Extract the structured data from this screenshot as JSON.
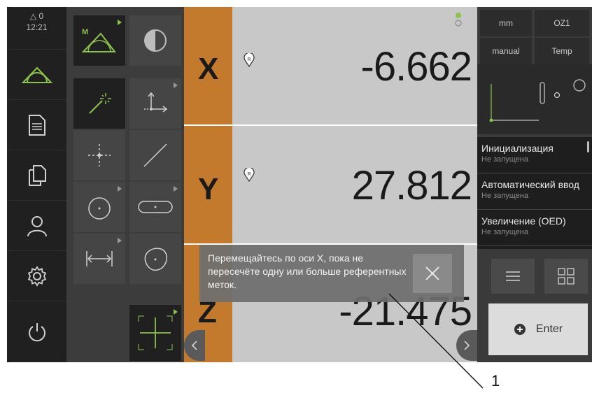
{
  "status_bar": {
    "delta_count": "0",
    "time": "12:21"
  },
  "nav": {
    "items": [
      {
        "icon": "measure-icon"
      },
      {
        "icon": "document-icon"
      },
      {
        "icon": "files-icon"
      },
      {
        "icon": "user-icon"
      },
      {
        "icon": "settings-icon"
      },
      {
        "icon": "power-icon"
      }
    ]
  },
  "axes": [
    {
      "label": "X",
      "value": "-6.662"
    },
    {
      "label": "Y",
      "value": "27.812"
    },
    {
      "label": "Z",
      "value": "-21.475"
    }
  ],
  "right_panel": {
    "unit": "mm",
    "zone": "OZ1",
    "mode": "manual",
    "temp": "Temp",
    "commands": [
      {
        "title": "Инициализация",
        "status": "Не запущена"
      },
      {
        "title": "Автоматический ввод",
        "status": "Не запущена"
      },
      {
        "title": "Увеличение (OED)",
        "status": "Не запущена"
      }
    ],
    "enter_label": "Enter"
  },
  "toast": {
    "message": "Перемещайтесь по оси X, пока не пересечёте одну или больше референтных меток."
  },
  "callout": {
    "number": "1"
  },
  "colors": {
    "accent": "#8bc34a",
    "axis_tab": "#c47a2c",
    "axis_bg": "#c8c8c8"
  }
}
